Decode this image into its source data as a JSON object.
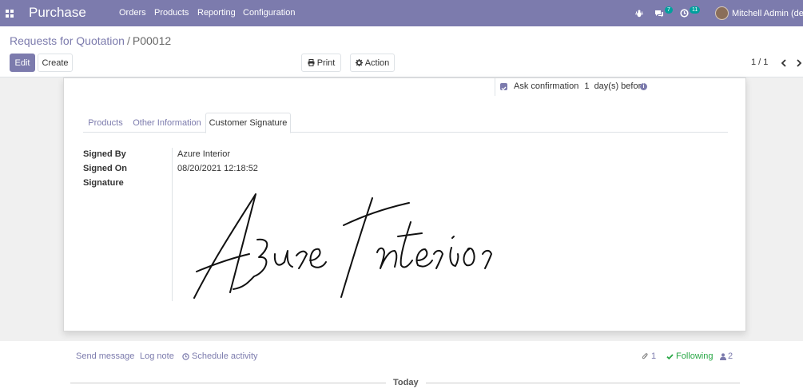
{
  "navbar": {
    "brand": "Purchase",
    "menu": [
      "Orders",
      "Products",
      "Reporting",
      "Configuration"
    ],
    "messages_count": "7",
    "activities_count": "11",
    "user": "Mitchell Admin (dem"
  },
  "control_panel": {
    "breadcrumb": {
      "parent": "Requests for Quotation",
      "separator": "/",
      "current": "P00012"
    },
    "buttons": {
      "edit": "Edit",
      "create": "Create",
      "print": "Print",
      "action": "Action"
    },
    "pager": "1 / 1"
  },
  "form": {
    "ask_confirmation": {
      "label_before": "Ask confirmation",
      "value": "1",
      "label_after": "day(s) before",
      "checked": true
    },
    "tabs": [
      "Products",
      "Other Information",
      "Customer Signature"
    ],
    "active_tab": "Customer Signature",
    "fields": {
      "signed_by_label": "Signed By",
      "signed_by_value": "Azure Interior",
      "signed_on_label": "Signed On",
      "signed_on_value": "08/20/2021 12:18:52",
      "signature_label": "Signature"
    }
  },
  "chatter": {
    "send_message": "Send message",
    "log_note": "Log note",
    "schedule_activity": "Schedule activity",
    "attachments_count": "1",
    "following": "Following",
    "followers_count": "2",
    "today": "Today"
  },
  "colors": {
    "brand": "#7c7bad",
    "accent_badge": "#00a09d",
    "following": "#28a745"
  }
}
